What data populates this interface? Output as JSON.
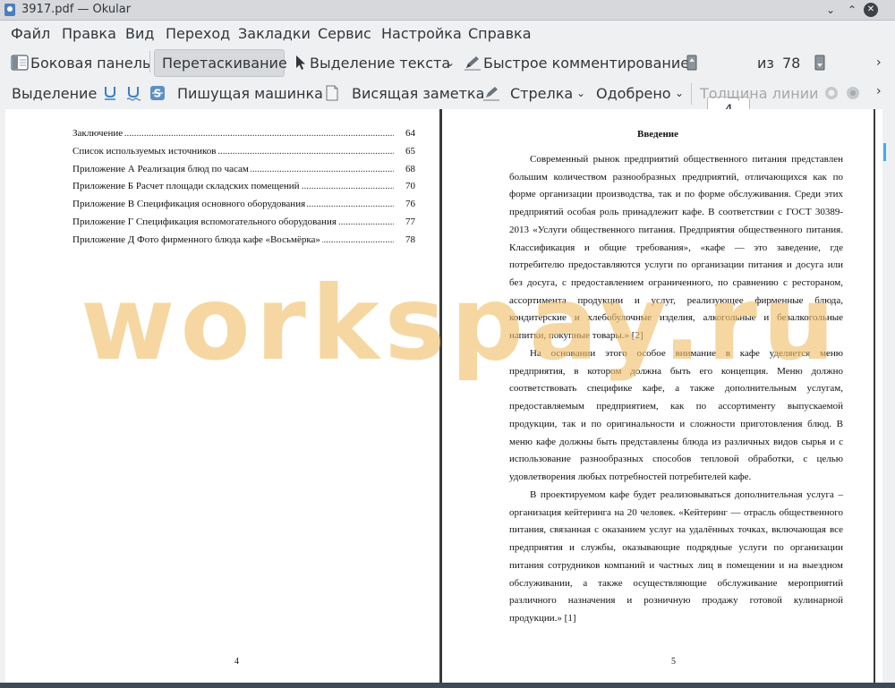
{
  "window": {
    "title": "3917.pdf — Okular"
  },
  "menubar": [
    "Файл",
    "Правка",
    "Вид",
    "Переход",
    "Закладки",
    "Сервис",
    "Настройка",
    "Справка"
  ],
  "toolbar1": {
    "sidebar": "Боковая панель",
    "browse": "Перетаскивание",
    "text_select": "Выделение текста",
    "quick_annot": "Быстрое комментирование",
    "current_page": "4",
    "of_label": "из",
    "total_pages": "78"
  },
  "toolbar2": {
    "highlight": "Выделение",
    "typewriter": "Пишущая машинка",
    "popup_note": "Висящая заметка",
    "arrow": "Стрелка",
    "stamp": "Одобрено",
    "line_width": "Толщина линии"
  },
  "icons": [
    "app-icon",
    "sidebar-icon",
    "cursor-icon",
    "pen-icon",
    "page-up-icon",
    "page-down-icon",
    "underline-icon",
    "squiggle-icon",
    "strikeout-icon",
    "note-icon",
    "brush-icon",
    "stamp-icon",
    "chevron-down-icon",
    "chevron-right-icon"
  ],
  "left_page": {
    "toc": [
      {
        "title": "Заключение",
        "page": "64"
      },
      {
        "title": "Список используемых источников",
        "page": "65"
      },
      {
        "title": "Приложение А Реализация блюд по часам",
        "page": "68"
      },
      {
        "title": "Приложение Б Расчет площади складских помещений",
        "page": "70"
      },
      {
        "title": "Приложение В Спецификация основного оборудования",
        "page": "76"
      },
      {
        "title": "Приложение Г Спецификация вспомогательного оборудования",
        "page": "77"
      },
      {
        "title": "Приложение Д Фото фирменного блюда кафе «Восьмёрка»",
        "page": "78"
      }
    ],
    "page_number": "4"
  },
  "right_page": {
    "heading": "Введение",
    "paragraphs": [
      "Современный рынок предприятий общественного питания представлен большим количеством разнообразных предприятий, отличающихся как по форме организации производства, так и по форме обслуживания. Среди этих предприятий особая роль принадлежит кафе. В соответствии с ГОСТ 30389-2013 «Услуги общественного питания. Предприятия общественного питания. Классификация и общие требования», «кафе — это заведение, где потребителю предоставляются услуги по организации питания и досуга или без досуга, с предоставлением ограниченного, по сравнению с рестораном, ассортимента продукции и услуг, реализующее фирменные блюда, кондитерские и хлебобулочные изделия, алкогольные и безалкогольные напитки, покупные товары.» [2]",
      "На основании этого особое внимание в кафе уделяется меню предприятия, в котором должна быть его концепция. Меню должно соответствовать специфике кафе, а также дополнительным услугам, предоставляемым предприятием, как по ассортименту выпускаемой продукции, так и по оригинальности и сложности приготовления блюд. В меню кафе должны быть представлены блюда из различных видов сырья и с использование разнообразных способов тепловой обработки, с целью удовлетворения любых потребностей потребителей кафе.",
      "В проектируемом кафе будет реализовываться дополнительная услуга – организация кейтеринга на 20 человек. «Кейтеринг — отрасль общественного питания, связанная с оказанием услуг на удалённых точках, включающая все предприятия и службы, оказывающие подрядные услуги по организации питания сотрудников компаний и частных лиц в помещении и на выездном обслуживании, а также осуществляющие обслуживание мероприятий различного назначения и розничную продажу готовой кулинарной продукции.» [1]"
    ],
    "page_number": "5"
  },
  "watermark": "workspay.ru",
  "colors": {
    "accent": "#3daee9",
    "window_bg": "#eff0f1",
    "watermark": "#f0be69"
  }
}
